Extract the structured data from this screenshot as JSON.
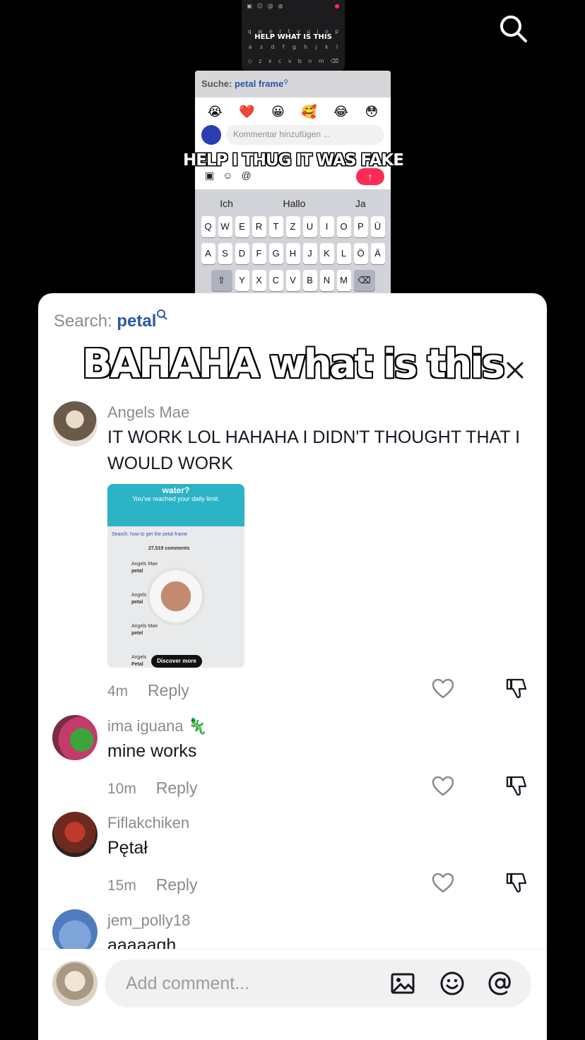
{
  "background_screenshot": {
    "mini_caption": "HELP WHAT IS THIS",
    "mini_rows": [
      [
        "q",
        "w",
        "e",
        "r",
        "t",
        "y",
        "u",
        "i",
        "o",
        "p"
      ],
      [
        "a",
        "s",
        "d",
        "f",
        "g",
        "h",
        "j",
        "k",
        "l"
      ],
      [
        "z",
        "x",
        "c",
        "v",
        "b",
        "n",
        "m"
      ]
    ],
    "search_prefix": "Suche:",
    "search_query": "petal frame",
    "emojis": [
      "😭",
      "❤️",
      "😀",
      "🥰",
      "😂",
      "😳"
    ],
    "input_placeholder": "Kommentar hinzufügen ...",
    "caption": "HELP I THUG IT WAS FAKE",
    "suggestions": [
      "Ich",
      "Hallo",
      "Ja"
    ],
    "keyboard_rows": [
      [
        "Q",
        "W",
        "E",
        "R",
        "T",
        "Z",
        "U",
        "I",
        "O",
        "P",
        "Ü"
      ],
      [
        "A",
        "S",
        "D",
        "F",
        "G",
        "H",
        "J",
        "K",
        "L",
        "Ö",
        "Ä"
      ],
      [
        "Y",
        "X",
        "C",
        "V",
        "B",
        "N",
        "M"
      ]
    ]
  },
  "sheet": {
    "search_prefix": "Search:",
    "search_query": "petal",
    "overlay_title": "BAHAHA what is this"
  },
  "comments": [
    {
      "user": "Angels Mae",
      "text": "IT WORK LOL HAHAHA I DIDN'T THOUGHT THAT I WOULD WORK",
      "time": "4m",
      "reply": "Reply",
      "attachment": {
        "teal_title": "water?",
        "teal_sub": "You've reached your daily limit.",
        "search": "Search: how to get the petal frame",
        "count": "27,519 comments",
        "rows": [
          {
            "user": "Angels Mae",
            "text": "petal"
          },
          {
            "user": "Angels M",
            "text": "petal"
          },
          {
            "user": "Angels Mae",
            "text": "petel"
          },
          {
            "user": "Angels",
            "text": "Petal"
          }
        ],
        "discover": "Discover more"
      }
    },
    {
      "user": "ima iguana",
      "user_emoji": "🦎",
      "text": "mine works",
      "time": "10m",
      "reply": "Reply"
    },
    {
      "user": "Fiflakchiken",
      "text": "Pętał",
      "time": "15m",
      "reply": "Reply"
    },
    {
      "user": "jem_polly18",
      "text": "aaaaagh"
    }
  ],
  "composer": {
    "placeholder": "Add comment..."
  },
  "colors": {
    "accent": "#fe2c55",
    "link_blue": "#2b57a8",
    "muted": "#8a8b91"
  }
}
